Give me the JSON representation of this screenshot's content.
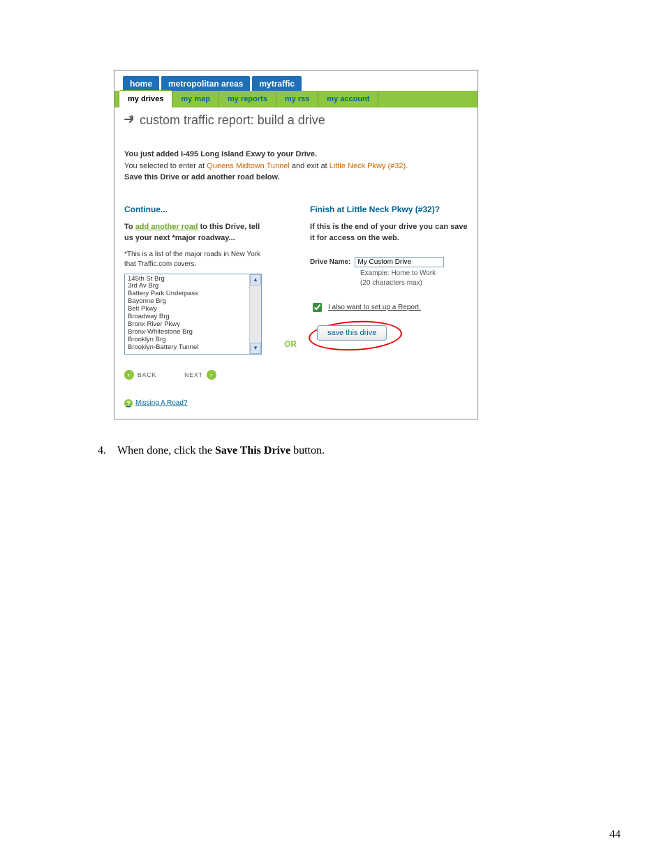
{
  "top_tabs": {
    "home": "home",
    "metro": "metropolitan areas",
    "mytraffic": "mytraffic"
  },
  "sub_tabs": {
    "drives": "my drives",
    "map": "my map",
    "reports": "my reports",
    "rss": "my rss",
    "account": "my account"
  },
  "page_title": "custom traffic report: build a drive",
  "intro": {
    "line1_pre": "You just added ",
    "line1_bold": "I-495 Long Island Exwy",
    "line1_post": " to your Drive.",
    "line2_pre": "You selected to enter at ",
    "line2_link1": "Queens Midtown Tunnel",
    "line2_mid": " and exit at ",
    "line2_link2": "Little Neck Pkwy (#32)",
    "line2_end": ".",
    "line3": "Save this Drive or add another road below."
  },
  "left": {
    "heading": "Continue...",
    "sub_pre": "To ",
    "sub_link": "add another road",
    "sub_post": " to this Drive, tell us your next *major roadway...",
    "note": "*This is a list of the major roads in New York that Traffic.com covers.",
    "roads": [
      "145th St Brg",
      "3rd Av Brg",
      "Battery Park Underpass",
      "Bayonne Brg",
      "Belt Pkwy",
      "Broadway Brg",
      "Bronx River Pkwy",
      "Bronx-Whitestone Brg",
      "Brooklyn Brg",
      "Brooklyn-Battery Tunnel"
    ],
    "back": "BACK",
    "next": "NEXT",
    "missing": "Missing A Road?"
  },
  "or": "OR",
  "right": {
    "heading": "Finish at Little Neck Pkwy (#32)?",
    "body": "If this is the end of your drive you can save it for access on the web.",
    "label": "Drive Name:",
    "input_value": "My Custom Drive",
    "hint1": "Example: Home to Work",
    "hint2": "(20 characters max)",
    "checkbox_label": "I also want to set up a Report.",
    "save_btn": "save this drive"
  },
  "instruction": {
    "num": "4.",
    "pre": "When done, click the ",
    "bold": "Save This Drive",
    "post": " button."
  },
  "page_num": "44"
}
